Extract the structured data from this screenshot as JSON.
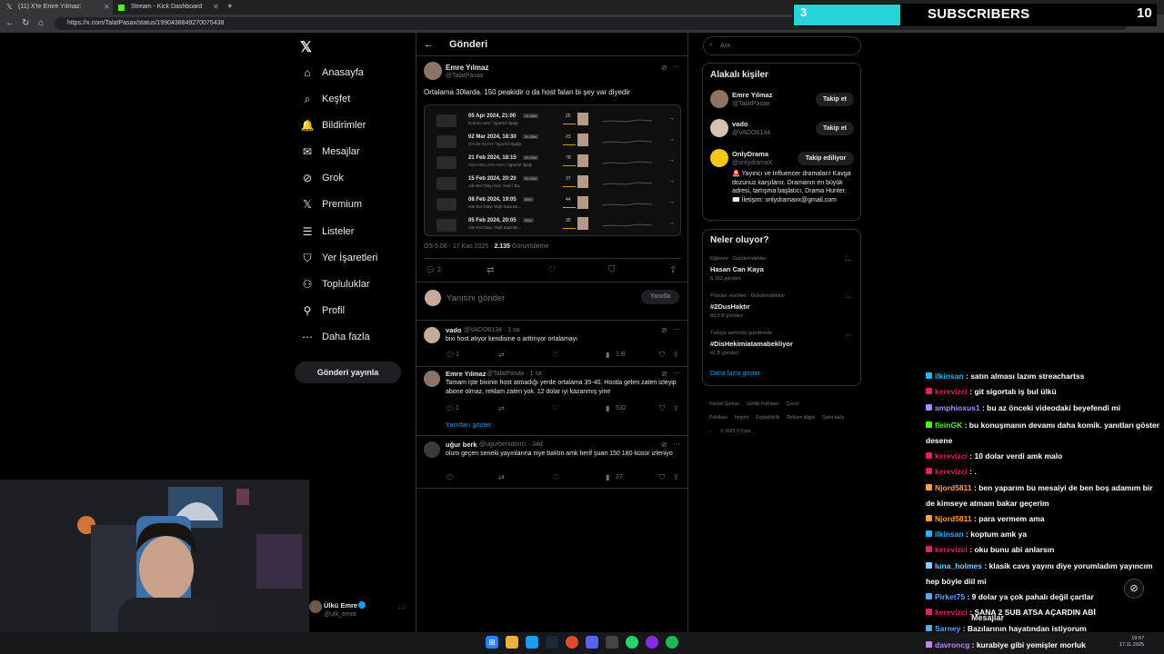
{
  "browser": {
    "tabs": [
      {
        "label": "(11) X'te Emre Yılmaz: \"@VADO6134",
        "active": true
      },
      {
        "label": "Stream - Kick Dashboard",
        "active": false
      }
    ],
    "new_tab": "+",
    "url": "https://x.com/TalatPasax/status/1990436849270075438"
  },
  "stream_overlay": {
    "sub_count": "3",
    "label": "SUBSCRIBERS",
    "goal": "10",
    "progress": 0.3
  },
  "nav": {
    "logo": "𝕏",
    "items": [
      {
        "label": "Anasayfa",
        "icon": "home-icon",
        "glyph": "⌂"
      },
      {
        "label": "Keşfet",
        "icon": "search-icon",
        "glyph": "⌕"
      },
      {
        "label": "Bildirimler",
        "icon": "bell-icon",
        "glyph": "🔔"
      },
      {
        "label": "Mesajlar",
        "icon": "mail-icon",
        "glyph": "✉"
      },
      {
        "label": "Grok",
        "icon": "grok-icon",
        "glyph": "⊘"
      },
      {
        "label": "Premium",
        "icon": "x-icon",
        "glyph": "𝕏"
      },
      {
        "label": "Listeler",
        "icon": "list-icon",
        "glyph": "☰"
      },
      {
        "label": "Yer İşaretleri",
        "icon": "bookmark-icon",
        "glyph": "⛉"
      },
      {
        "label": "Topluluklar",
        "icon": "people-icon",
        "glyph": "⚇"
      },
      {
        "label": "Profil",
        "icon": "user-icon",
        "glyph": "⚲"
      },
      {
        "label": "Daha fazla",
        "icon": "more-icon",
        "glyph": "⋯"
      }
    ],
    "post_button": "Gönderi yayınla",
    "account": {
      "name": "Ülkü Emre",
      "handle": "@ulk_emre"
    }
  },
  "center": {
    "header": "Gönderi",
    "tweet": {
      "name": "Emre Yılmaz",
      "handle": "@TalatPasax",
      "text": "Ortalama 30larda. 150 peakidir o da host falan bi şey var diyedir",
      "time": "ÖS 6:08 · 17 Kas 2025 · ",
      "views": "2.135",
      "views_label": " Görüntüleme",
      "replies": "2"
    },
    "embed_rows": [
      {
        "date": "05 Apr 2024, 21:00",
        "sub": "İş bura nere / İşportol Ilgağı",
        "badge": "1h 46m",
        "num": "25"
      },
      {
        "date": "02 Mar 2024, 18:30",
        "sub": "OYUN OLAYI / İşportol Ilgağı",
        "badge": "2h 30m",
        "num": "23"
      },
      {
        "date": "21 Feb 2024, 18:15",
        "sub": "AGA NOLUYO AGA / İşportol Ilgağı",
        "badge": "2h 20m",
        "num": "78"
      },
      {
        "date": "15 Feb 2024, 20:20",
        "sub": "Aile Evi Olayı Kick Yeşil / Bu...",
        "badge": "3h 10m",
        "num": "37"
      },
      {
        "date": "08 Feb 2024, 19:05",
        "sub": "Aile Evi Olayı Yeşil Saat Bu...",
        "badge": "46m",
        "num": "44"
      },
      {
        "date": "05 Feb 2024, 20:05",
        "sub": "Aile Evi Olayı Yeşil Saat Bu...",
        "badge": "25m",
        "num": "30"
      }
    ],
    "reply_placeholder": "Yanıtını gönder",
    "reply_button": "Yanıtla",
    "replies": [
      {
        "name": "vado",
        "handle": "@VADO6134 · 1 sa",
        "text": "bixi host atıyor kendisine o arttırıyor ortalamayı",
        "replies": "1",
        "views": "1 B"
      },
      {
        "name": "Emre Yılmaz",
        "handle": "@TalatPasax · 1 sa",
        "text": "Tamam işte bixinin host atmadığı yerde ortalama 35-40. Hostla gelen zaten izleyip abone olmaz, reklam zaten yok. 12 dolar iyi kazanmış yine",
        "replies": "1",
        "views": "532",
        "show_replies": "Yanıtları göster"
      },
      {
        "name": "uğur berk",
        "handle": "@ugurberkdmrci · 34d",
        "text": "olum geçen seneki yayınlarına niye baktın amk herif şuan 150 180 küsür izleniyo",
        "replies": "",
        "views": "27"
      }
    ]
  },
  "right": {
    "search_placeholder": "Ara",
    "related_title": "Alakalı kişiler",
    "people": [
      {
        "name": "Emre Yılmaz",
        "handle": "@TalatPasax",
        "button": "Takip et"
      },
      {
        "name": "vado",
        "handle": "@VADO6134",
        "button": "Takip et"
      },
      {
        "name": "OnlyDrama",
        "handle": "@onlydramaX",
        "button": "Takip ediliyor",
        "bio": "🚨 Yayıncı ve Influencer dramaları! Kavga dozunuz karşılanır. Dramanın en büyük adresi, tartışma başlatıcı, Drama Hunter. ✉️ İletişim: onlydramaxx@gmail.com"
      }
    ],
    "trends_title": "Neler oluyor?",
    "trends": [
      {
        "category": "Eğlence · Gündemdekiler",
        "name": "Hasan Can Kaya",
        "count": "5.153 gönderi"
      },
      {
        "category": "Popüler resimler · Gündemdekiler",
        "name": "#2DusHaktır",
        "count": "89,5 B gönderi"
      },
      {
        "category": "Türkiye tarihinde gündemde",
        "name": "#DisHekimiatamabekliyor",
        "count": "41 B gönderi"
      }
    ],
    "show_more": "Daha fazla göster",
    "footer": [
      "Hizmet Şartları",
      "Gizlilik Politikası",
      "Çerez Politikası",
      "Imprint",
      "Erişilebilirlik",
      "Reklam bilgisi",
      "Daha fazla ...",
      "© 2025 X Corp."
    ]
  },
  "chat": {
    "messages": [
      {
        "user": "ilkinsan",
        "color": "#2ab4ff",
        "text": " : satın alması lazım streachartss"
      },
      {
        "user": "kerevizci",
        "color": "#e0245e",
        "text": " : git sigortalı iş bul ülkü"
      },
      {
        "user": "amphioxus1",
        "color": "#a78bfa",
        "text": " : bu az önceki videodaki beyefendi mi"
      },
      {
        "user": "fleinGK",
        "color": "#53fc18",
        "text": " : bu konuşmanın devamı daha komik. yanıtları göster desene"
      },
      {
        "user": "kerevizci",
        "color": "#e0245e",
        "text": " : 10 dolar verdi amk malo"
      },
      {
        "user": "kerevizci",
        "color": "#e0245e",
        "text": " : ."
      },
      {
        "user": "Njord5811",
        "color": "#ff9f43",
        "text": " : ben yaparım bu mesaiyi de ben boş adamım bir de kimseye atmam bakar geçerim"
      },
      {
        "user": "Njord5811",
        "color": "#ff9f43",
        "text": " : para vermem ama"
      },
      {
        "user": "ilkinsan",
        "color": "#2ab4ff",
        "text": " : koptum amk ya"
      },
      {
        "user": "kerevizci",
        "color": "#e0245e",
        "text": " : oku bunu abi anlarsın"
      },
      {
        "user": "luna_holmes",
        "color": "#7dd3fc",
        "text": " : klasik cavs yayını diye yorumladım yayıncım hep böyle diil mi"
      },
      {
        "user": "Pirket75",
        "color": "#60a5fa",
        "text": " : 9 dolar ya çok pahalı değil çartlar"
      },
      {
        "user": "kerevizci",
        "color": "#e0245e",
        "text": " : SANA 2 SUB ATSA AÇARDIN ABİ"
      },
      {
        "user": "Sarney",
        "color": "#60a5fa",
        "text": " : Bazılarının hayatından istiyorum"
      },
      {
        "user": "davroncg",
        "color": "#c084fc",
        "text": " : kurabiye gibi yemişler morluk"
      }
    ],
    "messages_label": "Mesajlar"
  },
  "taskbar": {
    "time": "19:57",
    "date": "17.11.2025"
  }
}
